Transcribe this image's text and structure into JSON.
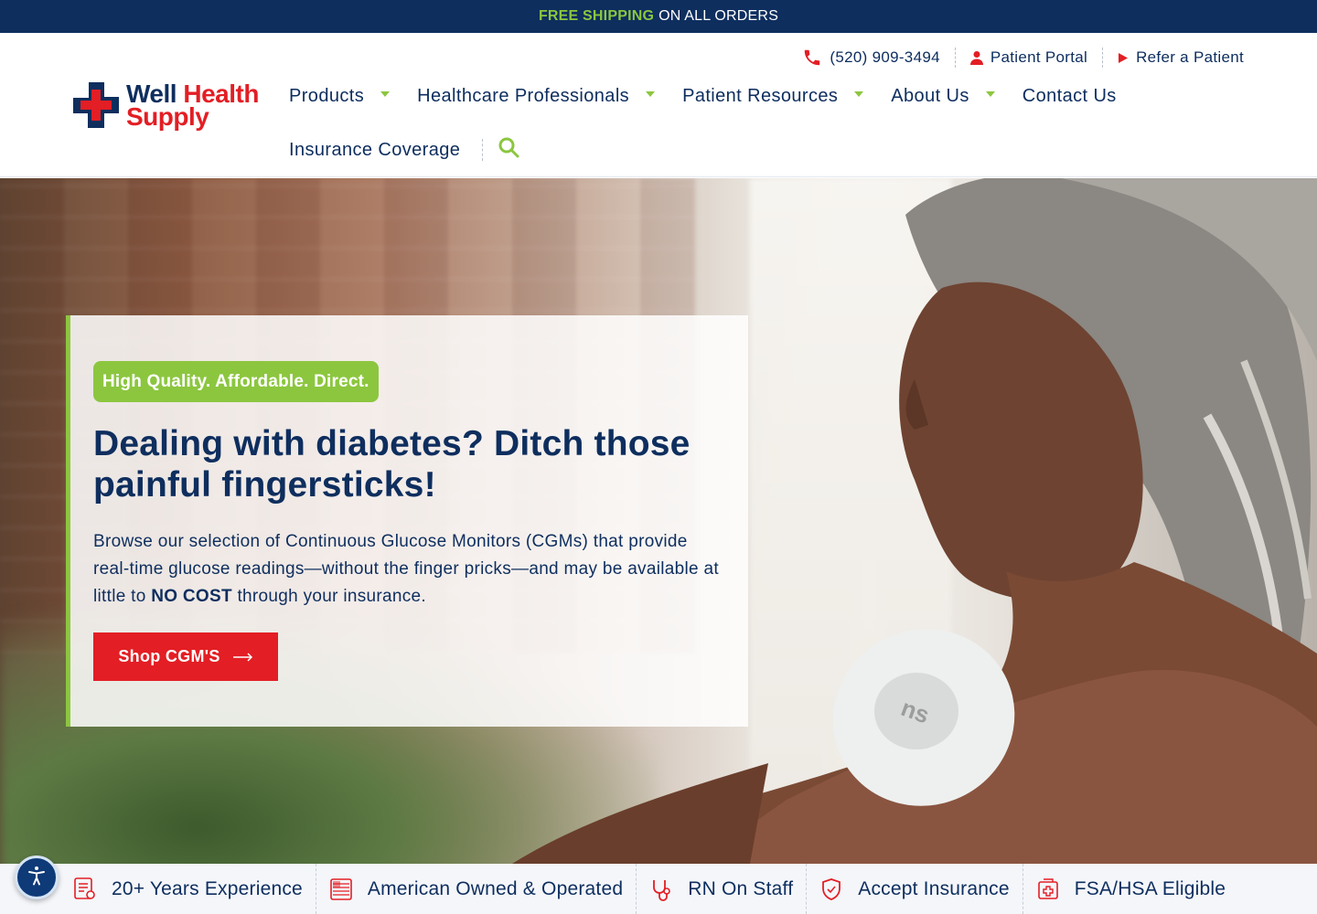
{
  "promo": {
    "highlight": "FREE SHIPPING",
    "text": "ON ALL ORDERS"
  },
  "utility": {
    "phone": "(520) 909-3494",
    "portal": "Patient Portal",
    "refer": "Refer a Patient"
  },
  "brand": {
    "line1a": "Well ",
    "line1b": "Health",
    "line2": "Supply"
  },
  "nav": {
    "items": [
      {
        "label": "Products"
      },
      {
        "label": "Healthcare Professionals"
      },
      {
        "label": "Patient Resources"
      },
      {
        "label": "About Us"
      },
      {
        "label": "Contact Us"
      },
      {
        "label": "Insurance Coverage"
      }
    ]
  },
  "hero": {
    "badge": "High Quality. Affordable. Direct.",
    "headline": "Dealing with diabetes? Ditch those painful fingersticks!",
    "body_a": "Browse our selection of Continuous Glucose Monitors (CGMs) that provide real-time glucose readings—without the finger pricks—and may be available at little to ",
    "body_bold": "NO COST",
    "body_b": " through your insurance.",
    "cta": "Shop CGM'S",
    "sensor_mark": "ns"
  },
  "features": [
    {
      "label": "20+ Years Experience",
      "icon": "certificate-icon"
    },
    {
      "label": "American Owned & Operated",
      "icon": "flag-icon"
    },
    {
      "label": "RN On Staff",
      "icon": "stethoscope-icon"
    },
    {
      "label": "Accept Insurance",
      "icon": "shield-icon"
    },
    {
      "label": "FSA/HSA Eligible",
      "icon": "medical-card-icon"
    }
  ],
  "colors": {
    "navy": "#0e2e5e",
    "green": "#8cc63f",
    "red": "#e31e24"
  }
}
